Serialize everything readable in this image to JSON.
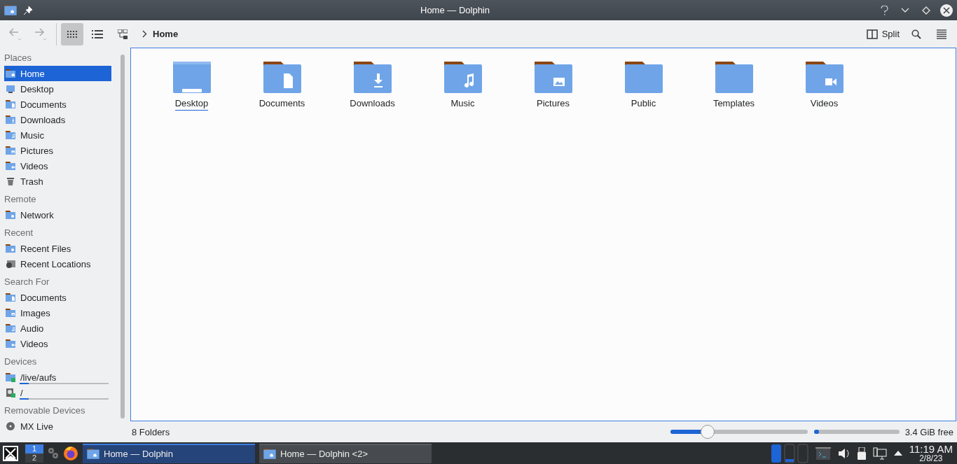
{
  "window": {
    "title": "Home — Dolphin"
  },
  "toolbar": {
    "back": {
      "disabled": true
    },
    "forward": {
      "disabled": true
    },
    "views": [
      {
        "kind": "icons",
        "selected": true
      },
      {
        "kind": "details",
        "selected": false
      },
      {
        "kind": "tree",
        "selected": false
      }
    ],
    "breadcrumb": "Home",
    "split": "Split"
  },
  "sidebar": {
    "sections": [
      {
        "title": "Places",
        "items": [
          {
            "label": "Home",
            "kind": "home",
            "selected": true
          },
          {
            "label": "Desktop",
            "kind": "desktop",
            "selected": false
          },
          {
            "label": "Documents",
            "kind": "documents",
            "selected": false
          },
          {
            "label": "Downloads",
            "kind": "downloads",
            "selected": false
          },
          {
            "label": "Music",
            "kind": "music",
            "selected": false
          },
          {
            "label": "Pictures",
            "kind": "pictures",
            "selected": false
          },
          {
            "label": "Videos",
            "kind": "videos",
            "selected": false
          },
          {
            "label": "Trash",
            "kind": "trash",
            "selected": false
          }
        ]
      },
      {
        "title": "Remote",
        "items": [
          {
            "label": "Network",
            "kind": "network",
            "selected": false
          }
        ]
      },
      {
        "title": "Recent",
        "items": [
          {
            "label": "Recent Files",
            "kind": "recent",
            "selected": false
          },
          {
            "label": "Recent Locations",
            "kind": "locations",
            "selected": false
          }
        ]
      },
      {
        "title": "Search For",
        "items": [
          {
            "label": "Documents",
            "kind": "documents",
            "selected": false
          },
          {
            "label": "Images",
            "kind": "pictures",
            "selected": false
          },
          {
            "label": "Audio",
            "kind": "music",
            "selected": false
          },
          {
            "label": "Videos",
            "kind": "videos",
            "selected": false
          }
        ]
      },
      {
        "title": "Devices",
        "items": [
          {
            "label": "/live/aufs",
            "kind": "drive-folder",
            "selected": false,
            "level": 0.1
          },
          {
            "label": "/",
            "kind": "drive",
            "selected": false,
            "level": 0.1
          }
        ]
      },
      {
        "title": "Removable Devices",
        "items": [
          {
            "label": "MX Live",
            "kind": "disc",
            "selected": false
          }
        ]
      }
    ]
  },
  "folders": [
    {
      "name": "Desktop",
      "kind": "desktop",
      "focused": true
    },
    {
      "name": "Documents",
      "kind": "documents",
      "focused": false
    },
    {
      "name": "Downloads",
      "kind": "downloads",
      "focused": false
    },
    {
      "name": "Music",
      "kind": "music",
      "focused": false
    },
    {
      "name": "Pictures",
      "kind": "pictures",
      "focused": false
    },
    {
      "name": "Public",
      "kind": "public",
      "focused": false
    },
    {
      "name": "Templates",
      "kind": "templates",
      "focused": false
    },
    {
      "name": "Videos",
      "kind": "videos",
      "focused": false
    }
  ],
  "status_bar": {
    "summary": "8 Folders",
    "zoom": {
      "level": 0.27
    },
    "space": {
      "level": 0.06
    },
    "free": "3.4 GiB free"
  },
  "taskbar": {
    "desktops": [
      {
        "label": "1",
        "selected": true
      },
      {
        "label": "2",
        "selected": false
      }
    ],
    "tasks": [
      {
        "title": "Home — Dolphin",
        "selected": true
      },
      {
        "title": "Home — Dolphin <2>",
        "selected": false
      }
    ],
    "time": "11:19 AM",
    "date": "2/8/23"
  }
}
